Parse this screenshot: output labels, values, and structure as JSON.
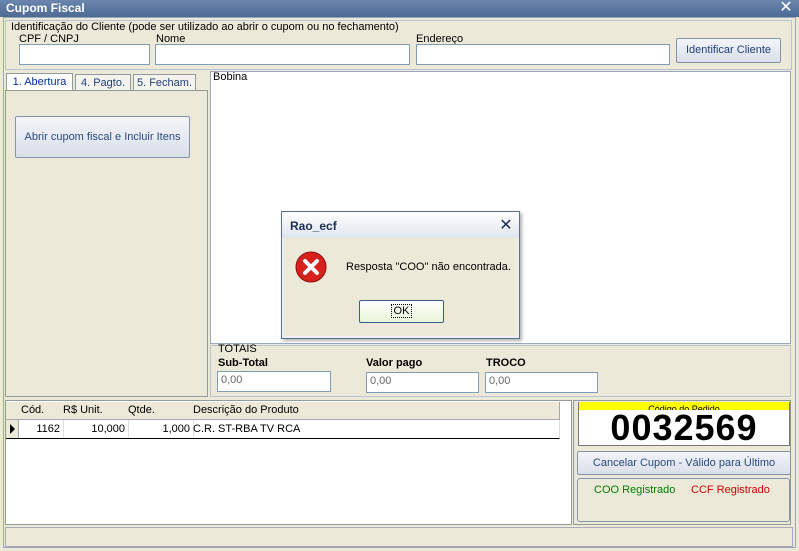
{
  "window": {
    "title": "Cupom Fiscal"
  },
  "identification": {
    "legend": "Identificação do Cliente (pode ser utilizado ao abrir o cupom ou no fechamento)",
    "cpf_label": "CPF / CNPJ",
    "nome_label": "Nome",
    "endereco_label": "Endereço",
    "cpf_value": "",
    "nome_value": "",
    "endereco_value": "",
    "identify_button": "Identificar Cliente"
  },
  "tabs": [
    {
      "label": "1. Abertura",
      "active": true
    },
    {
      "label": "4. Pagto.",
      "active": false
    },
    {
      "label": "5. Fecham.",
      "active": false
    }
  ],
  "left_panel": {
    "open_button": "Abrir cupom fiscal e Incluir Itens"
  },
  "bobina": {
    "label": "Bobina"
  },
  "totais": {
    "legend": "TOTAIS",
    "subtotal_label": "Sub-Total",
    "subtotal_value": "0,00",
    "valor_pago_label": "Valor pago",
    "valor_pago_value": "0,00",
    "troco_label": "TROCO",
    "troco_value": "0,00"
  },
  "grid": {
    "columns": [
      "Cód.",
      "R$ Unit.",
      "Qtde.",
      "Descrição do Produto"
    ],
    "rows": [
      {
        "cod": "1162",
        "unit": "10,000",
        "qtde": "1,000",
        "desc": "C.R. ST-RBA TV RCA"
      }
    ]
  },
  "pedido": {
    "header": "Código do Pedido",
    "code": "0032569",
    "cancel_button": "Cancelar Cupom - Válido para Último",
    "coo_status": "COO Registrado",
    "ccf_status": "CCF Registrado",
    "coo_color": "#008000",
    "ccf_color": "#d00000"
  },
  "dialog": {
    "title": "Rao_ecf",
    "message": "Resposta \"COO\" não encontrada.",
    "ok_button": "OK",
    "icon": "error-icon"
  },
  "colors": {
    "accent_yellow": "#ffff00",
    "error_red": "#d8201c"
  }
}
